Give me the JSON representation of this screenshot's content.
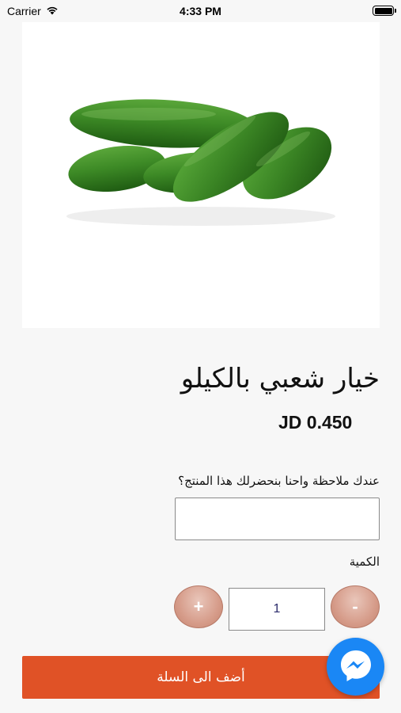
{
  "status_bar": {
    "carrier": "Carrier",
    "time": "4:33 PM"
  },
  "product": {
    "image_icon": "cucumbers-photo",
    "title": "خيار شعبي بالكيلو",
    "price": "JD 0.450"
  },
  "note": {
    "label": "عندك ملاحظة واحنا بنحضرلك هذا المنتج؟",
    "value": ""
  },
  "quantity": {
    "label": "الكمية",
    "value": "1",
    "plus_label": "+",
    "minus_label": "-"
  },
  "cart": {
    "add_label": "أضف الى السلة"
  },
  "messenger": {
    "icon": "messenger-icon",
    "color": "#1a87f5"
  },
  "colors": {
    "accent": "#e05226",
    "stepper": "#d69c8a"
  }
}
